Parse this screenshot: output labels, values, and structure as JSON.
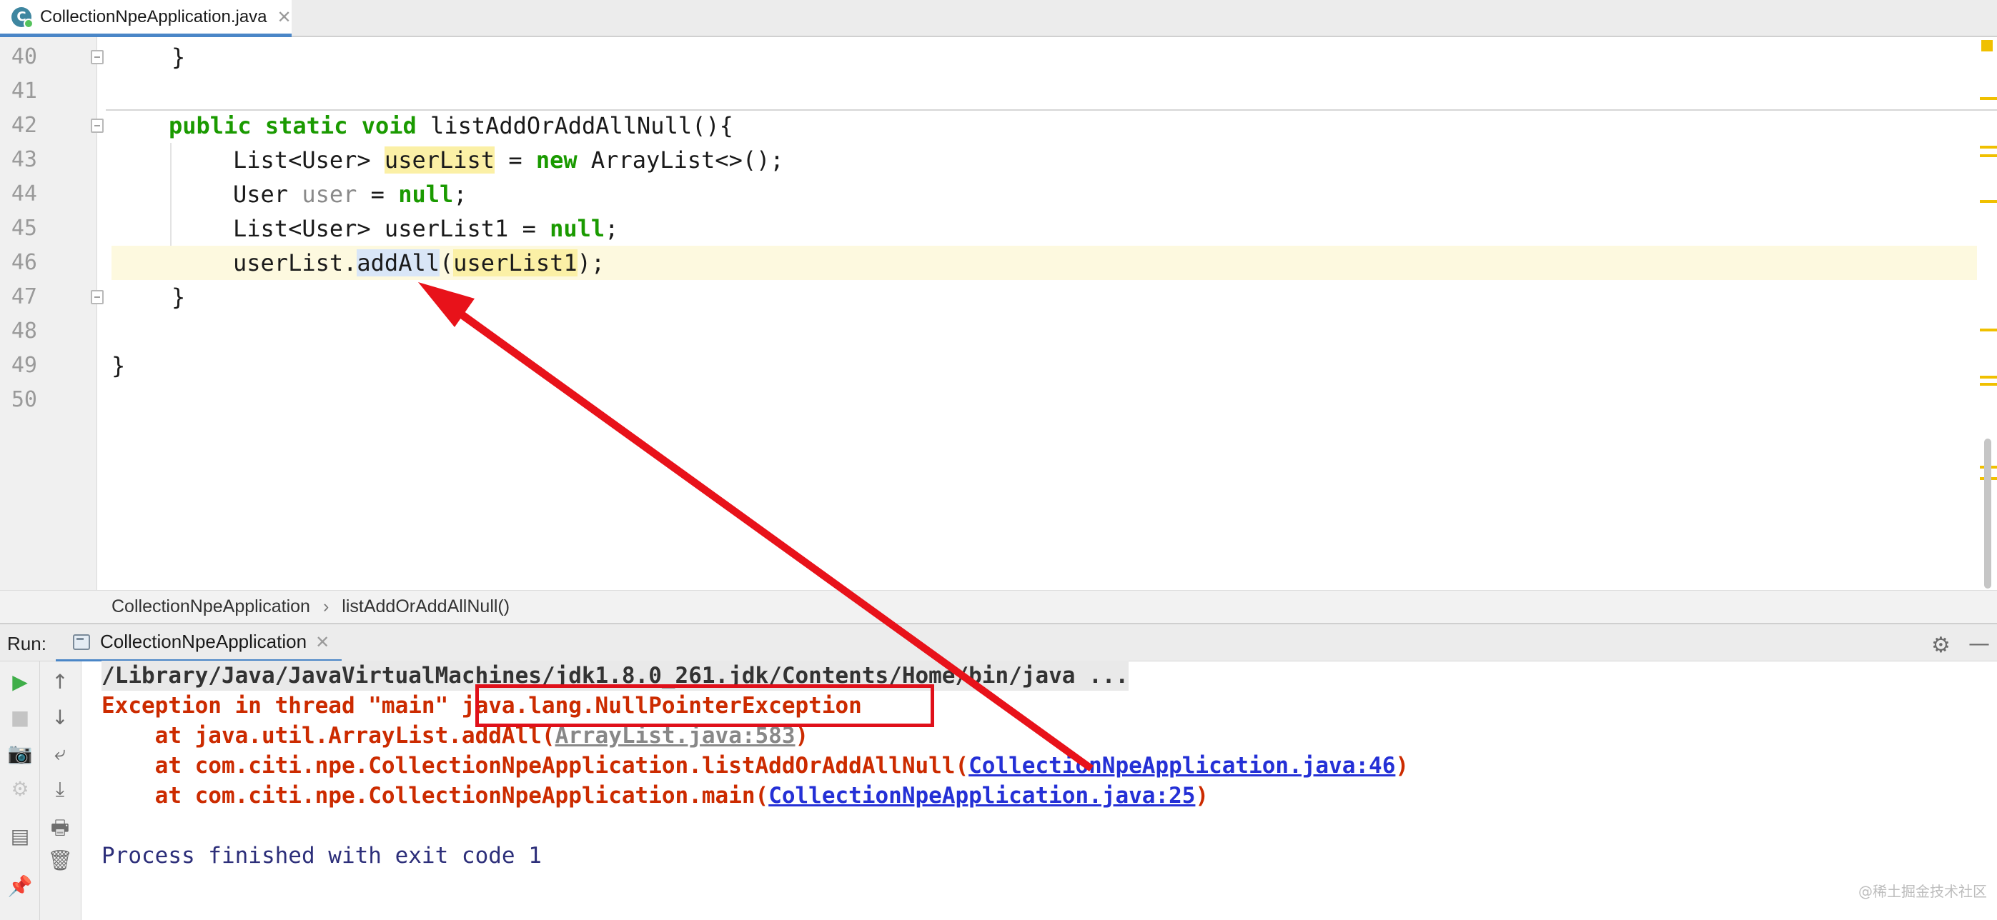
{
  "editor_tab": {
    "icon": "C",
    "label": "CollectionNpeApplication.java",
    "close": "✕"
  },
  "editor": {
    "line_numbers": [
      "40",
      "41",
      "42",
      "43",
      "44",
      "45",
      "46",
      "47",
      "48",
      "49",
      "50"
    ],
    "code": {
      "l40": "}",
      "l42_kw1": "public",
      "l42_kw2": "static",
      "l42_kw3": "void",
      "l42_rest": "listAddOrAddAllNull(){",
      "l43_a": "List<User> ",
      "l43_b": "userList",
      "l43_c": " = ",
      "l43_kw": "new",
      "l43_d": " ArrayList<>();",
      "l44_a": "User ",
      "l44_b": "user",
      "l44_c": " = ",
      "l44_kw": "null",
      "l44_d": ";",
      "l45_a": "List<User> userList1 = ",
      "l45_kw": "null",
      "l45_b": ";",
      "l46_a": "userList.",
      "l46_b": "addAll",
      "l46_c": "(",
      "l46_d": "userList1",
      "l46_e": ");",
      "l47": "}",
      "l49": "}"
    }
  },
  "breadcrumb": {
    "class": "CollectionNpeApplication",
    "separator": "›",
    "method": "listAddOrAddAllNull()"
  },
  "run_panel": {
    "label": "Run:",
    "tab_label": "CollectionNpeApplication",
    "tab_close": "✕",
    "settings_icon": "⚙",
    "minimize_icon": "—",
    "console": {
      "cmd": "/Library/Java/JavaVirtualMachines/jdk1.8.0_261.jdk/Contents/Home/bin/java ...",
      "ex_prefix": "Exception in thread \"main\" ",
      "ex_name": "java.lang.NullPointerException",
      "st1_a": "    at java.util.ArrayList.addAll(",
      "st1_link": "ArrayList.java:583",
      "st1_b": ")",
      "st2_a": "    at com.citi.npe.CollectionNpeApplication.listAddOrAddAllNull(",
      "st2_link": "CollectionNpeApplication.java:46",
      "st2_b": ")",
      "st3_a": "    at com.citi.npe.CollectionNpeApplication.main(",
      "st3_link": "CollectionNpeApplication.java:25",
      "st3_b": ")",
      "finished": "Process finished with exit code 1"
    },
    "toolbar_left": [
      "▶",
      "■",
      "📷",
      "⚙",
      "▤",
      "📌"
    ],
    "toolbar_right": [
      "↑",
      "↓",
      "⤶",
      "⤓",
      "🖶",
      "🗑"
    ]
  },
  "watermark": "@稀土掘金技术社区",
  "colors": {
    "keyword": "#1a9a00",
    "error": "#cc2b00",
    "link": "#2430d6",
    "annotation": "#e0101a",
    "tab_accent": "#4a86c7"
  }
}
